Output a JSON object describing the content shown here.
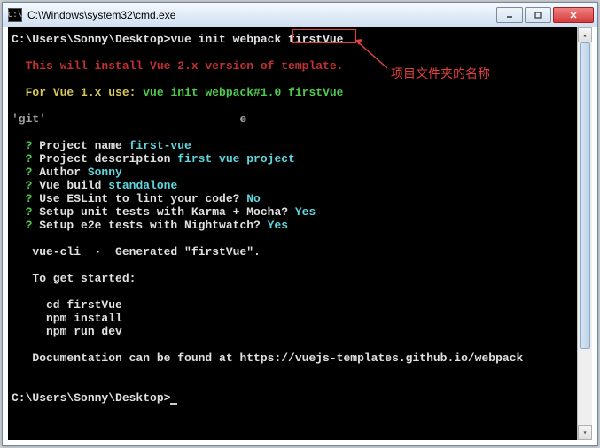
{
  "titlebar": {
    "title": "C:\\Windows\\system32\\cmd.exe",
    "icon_label": "C:\\"
  },
  "terminal": {
    "prompt1_path": "C:\\Users\\Sonny\\Desktop>",
    "prompt1_cmd": "vue init webpack firstVue",
    "warning": "  This will install Vue 2.x version of template.",
    "vue1_prefix": "  For Vue 1.x use: ",
    "vue1_cmd": "vue init webpack#1.0 firstVue",
    "git_line": "'git'",
    "git_char": "е",
    "q1_label": " Project name ",
    "q1_val": "first-vue",
    "q2_label": " Project description ",
    "q2_val": "first vue project",
    "q3_label": " Author ",
    "q3_val": "Sonny",
    "q4_label": " Vue build ",
    "q4_val": "standalone",
    "q5_label": " Use ESLint to lint your code? ",
    "q5_val": "No",
    "q6_label": " Setup unit tests with Karma + Mocha? ",
    "q6_val": "Yes",
    "q7_label": " Setup e2e tests with Nightwatch? ",
    "q7_val": "Yes",
    "gen_line": "   vue-cli  ·  Generated \"firstVue\".",
    "started": "   To get started:",
    "step1": "     cd firstVue",
    "step2": "     npm install",
    "step3": "     npm run dev",
    "docs": "   Documentation can be found at https://vuejs-templates.github.io/webpack",
    "prompt2_path": "C:\\Users\\Sonny\\Desktop>"
  },
  "annotation": {
    "text": "项目文件夹的名称"
  }
}
